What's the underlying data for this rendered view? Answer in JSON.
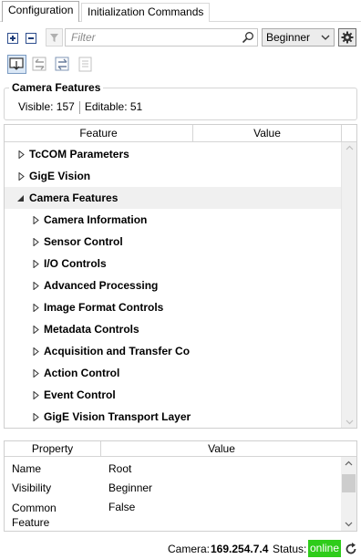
{
  "tabs": [
    {
      "label": "Configuration",
      "active": true
    },
    {
      "label": "Initialization Commands",
      "active": false
    }
  ],
  "toolbar": {
    "filter_placeholder": "Filter",
    "visibility_level": "Beginner"
  },
  "camera_features_group": {
    "title": "Camera Features",
    "visible_text": "Visible: 157",
    "editable_text": "Editable: 51"
  },
  "feature_tree": {
    "columns": [
      "Feature",
      "Value"
    ],
    "rows": [
      {
        "label": "TcCOM Parameters",
        "level": 0,
        "expanded": false
      },
      {
        "label": "GigE Vision",
        "level": 0,
        "expanded": false
      },
      {
        "label": "Camera Features",
        "level": 0,
        "expanded": true,
        "selected": true
      },
      {
        "label": "Camera Information",
        "level": 1,
        "expanded": false
      },
      {
        "label": "Sensor Control",
        "level": 1,
        "expanded": false
      },
      {
        "label": "I/O Controls",
        "level": 1,
        "expanded": false
      },
      {
        "label": "Advanced Processing",
        "level": 1,
        "expanded": false
      },
      {
        "label": "Image Format Controls",
        "level": 1,
        "expanded": false
      },
      {
        "label": "Metadata Controls",
        "level": 1,
        "expanded": false
      },
      {
        "label": "Acquisition and Transfer Co",
        "level": 1,
        "expanded": false
      },
      {
        "label": "Action Control",
        "level": 1,
        "expanded": false
      },
      {
        "label": "Event Control",
        "level": 1,
        "expanded": false
      },
      {
        "label": "GigE Vision Transport Layer",
        "level": 1,
        "expanded": false
      }
    ]
  },
  "property_grid": {
    "columns": [
      "Property",
      "Value"
    ],
    "rows": [
      {
        "property": "Name",
        "value": "Root"
      },
      {
        "property": "Visibility",
        "value": "Beginner"
      },
      {
        "property": "Common Feature",
        "value": "False"
      }
    ]
  },
  "statusbar": {
    "camera_label": "Camera:",
    "camera_ip": "169.254.7.4",
    "status_label": "Status:",
    "status_value": "online",
    "status_color": "#2ecc1a"
  },
  "colors": {
    "accent_blue": "#1e3c78",
    "selected_row": "#f0f0f0"
  }
}
